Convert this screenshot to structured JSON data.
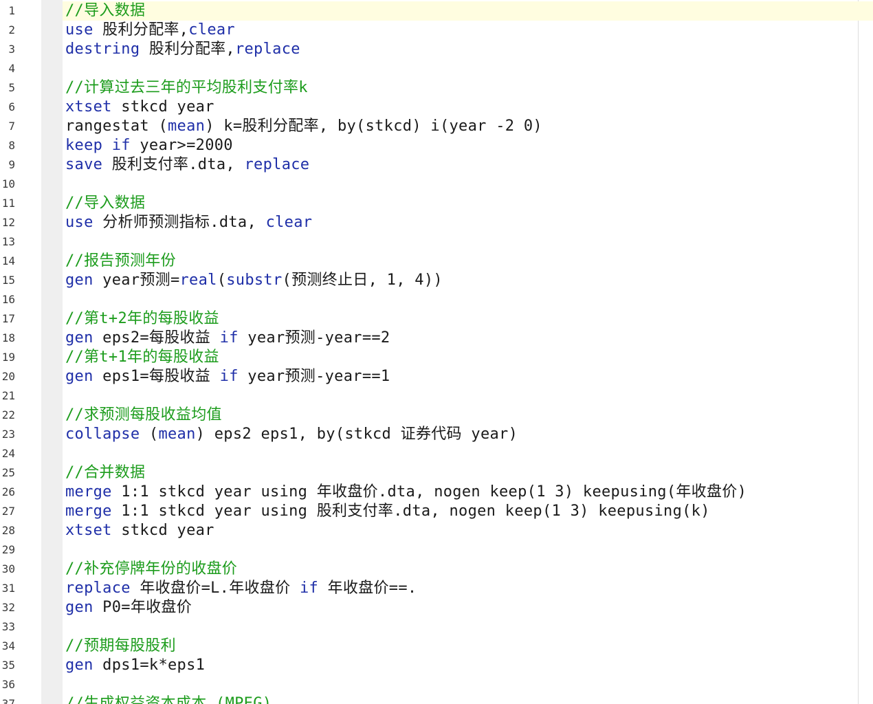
{
  "editor": {
    "current_line": 1,
    "colors": {
      "keyword": "#1f2fa8",
      "comment": "#1c9c1c",
      "text": "#1a1a1a",
      "line_number": "#3a3a3a",
      "current_line_bg": "#fffde0",
      "fold_strip": "#efefef"
    },
    "lines": [
      {
        "n": "1",
        "tokens": [
          {
            "t": "cm",
            "v": "//导入数据"
          }
        ]
      },
      {
        "n": "2",
        "tokens": [
          {
            "t": "kw",
            "v": "use"
          },
          {
            "t": "tx",
            "v": " 股利分配率,"
          },
          {
            "t": "kw",
            "v": "clear"
          }
        ]
      },
      {
        "n": "3",
        "tokens": [
          {
            "t": "kw",
            "v": "destring"
          },
          {
            "t": "tx",
            "v": " 股利分配率,"
          },
          {
            "t": "kw",
            "v": "replace"
          }
        ]
      },
      {
        "n": "4",
        "tokens": []
      },
      {
        "n": "5",
        "tokens": [
          {
            "t": "cm",
            "v": "//计算过去三年的平均股利支付率k"
          }
        ]
      },
      {
        "n": "6",
        "tokens": [
          {
            "t": "kw",
            "v": "xtset"
          },
          {
            "t": "tx",
            "v": " stkcd year"
          }
        ]
      },
      {
        "n": "7",
        "tokens": [
          {
            "t": "tx",
            "v": "rangestat ("
          },
          {
            "t": "kw",
            "v": "mean"
          },
          {
            "t": "tx",
            "v": ") k=股利分配率, by(stkcd) i(year -2 0)"
          }
        ]
      },
      {
        "n": "8",
        "tokens": [
          {
            "t": "kw",
            "v": "keep"
          },
          {
            "t": "tx",
            "v": " "
          },
          {
            "t": "kw",
            "v": "if"
          },
          {
            "t": "tx",
            "v": " year>=2000"
          }
        ]
      },
      {
        "n": "9",
        "tokens": [
          {
            "t": "kw",
            "v": "save"
          },
          {
            "t": "tx",
            "v": " 股利支付率.dta, "
          },
          {
            "t": "kw",
            "v": "replace"
          }
        ]
      },
      {
        "n": "10",
        "tokens": []
      },
      {
        "n": "11",
        "tokens": [
          {
            "t": "cm",
            "v": "//导入数据"
          }
        ]
      },
      {
        "n": "12",
        "tokens": [
          {
            "t": "kw",
            "v": "use"
          },
          {
            "t": "tx",
            "v": " 分析师预测指标.dta, "
          },
          {
            "t": "kw",
            "v": "clear"
          }
        ]
      },
      {
        "n": "13",
        "tokens": []
      },
      {
        "n": "14",
        "tokens": [
          {
            "t": "cm",
            "v": "//报告预测年份"
          }
        ]
      },
      {
        "n": "15",
        "tokens": [
          {
            "t": "kw",
            "v": "gen"
          },
          {
            "t": "tx",
            "v": " year预测="
          },
          {
            "t": "kw",
            "v": "real"
          },
          {
            "t": "tx",
            "v": "("
          },
          {
            "t": "kw",
            "v": "substr"
          },
          {
            "t": "tx",
            "v": "(预测终止日, 1, 4))"
          }
        ]
      },
      {
        "n": "16",
        "tokens": []
      },
      {
        "n": "17",
        "tokens": [
          {
            "t": "cm",
            "v": "//第t+2年的每股收益"
          }
        ]
      },
      {
        "n": "18",
        "tokens": [
          {
            "t": "kw",
            "v": "gen"
          },
          {
            "t": "tx",
            "v": " eps2=每股收益 "
          },
          {
            "t": "kw",
            "v": "if"
          },
          {
            "t": "tx",
            "v": " year预测-year==2"
          }
        ]
      },
      {
        "n": "19",
        "tokens": [
          {
            "t": "cm",
            "v": "//第t+1年的每股收益"
          }
        ]
      },
      {
        "n": "20",
        "tokens": [
          {
            "t": "kw",
            "v": "gen"
          },
          {
            "t": "tx",
            "v": " eps1=每股收益 "
          },
          {
            "t": "kw",
            "v": "if"
          },
          {
            "t": "tx",
            "v": " year预测-year==1"
          }
        ]
      },
      {
        "n": "21",
        "tokens": []
      },
      {
        "n": "22",
        "tokens": [
          {
            "t": "cm",
            "v": "//求预测每股收益均值"
          }
        ]
      },
      {
        "n": "23",
        "tokens": [
          {
            "t": "kw",
            "v": "collapse"
          },
          {
            "t": "tx",
            "v": " ("
          },
          {
            "t": "kw",
            "v": "mean"
          },
          {
            "t": "tx",
            "v": ") eps2 eps1, by(stkcd 证券代码 year)"
          }
        ]
      },
      {
        "n": "24",
        "tokens": []
      },
      {
        "n": "25",
        "tokens": [
          {
            "t": "cm",
            "v": "//合并数据"
          }
        ]
      },
      {
        "n": "26",
        "tokens": [
          {
            "t": "kw",
            "v": "merge"
          },
          {
            "t": "tx",
            "v": " 1:1 stkcd year using 年收盘价.dta, nogen keep(1 3) keepusing(年收盘价)"
          }
        ]
      },
      {
        "n": "27",
        "tokens": [
          {
            "t": "kw",
            "v": "merge"
          },
          {
            "t": "tx",
            "v": " 1:1 stkcd year using 股利支付率.dta, nogen keep(1 3) keepusing(k)"
          }
        ]
      },
      {
        "n": "28",
        "tokens": [
          {
            "t": "kw",
            "v": "xtset"
          },
          {
            "t": "tx",
            "v": " stkcd year"
          }
        ]
      },
      {
        "n": "29",
        "tokens": []
      },
      {
        "n": "30",
        "tokens": [
          {
            "t": "cm",
            "v": "//补充停牌年份的收盘价"
          }
        ]
      },
      {
        "n": "31",
        "tokens": [
          {
            "t": "kw",
            "v": "replace"
          },
          {
            "t": "tx",
            "v": " 年收盘价=L.年收盘价 "
          },
          {
            "t": "kw",
            "v": "if"
          },
          {
            "t": "tx",
            "v": " 年收盘价==."
          }
        ]
      },
      {
        "n": "32",
        "tokens": [
          {
            "t": "kw",
            "v": "gen"
          },
          {
            "t": "tx",
            "v": " P0=年收盘价"
          }
        ]
      },
      {
        "n": "33",
        "tokens": []
      },
      {
        "n": "34",
        "tokens": [
          {
            "t": "cm",
            "v": "//预期每股股利"
          }
        ]
      },
      {
        "n": "35",
        "tokens": [
          {
            "t": "kw",
            "v": "gen"
          },
          {
            "t": "tx",
            "v": " dps1=k*eps1"
          }
        ]
      },
      {
        "n": "36",
        "tokens": []
      },
      {
        "n": "37",
        "tokens": [
          {
            "t": "cm",
            "v": "//生成权益资本成本 (MPEG)"
          }
        ]
      }
    ]
  }
}
